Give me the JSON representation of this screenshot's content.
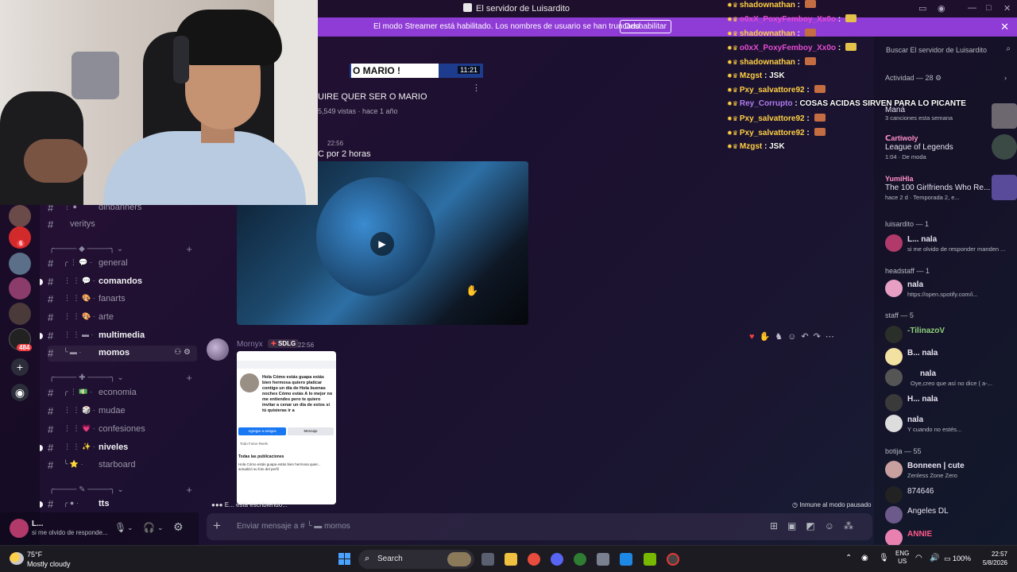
{
  "window": {
    "title": "El servidor de Luisardito"
  },
  "banner": {
    "text": "El modo Streamer está habilitado. Los nombres de usuario se han truncado.",
    "button": "Deshabilitar"
  },
  "server_rail": {
    "badges": [
      "6",
      "484"
    ]
  },
  "channels": {
    "items": [
      {
        "label": "dinbanners"
      },
      {
        "label": "veritys"
      },
      {
        "label": "general"
      },
      {
        "label": "comandos"
      },
      {
        "label": "fanarts"
      },
      {
        "label": "arte"
      },
      {
        "label": "multimedia"
      },
      {
        "label": "momos"
      },
      {
        "label": "economia"
      },
      {
        "label": "mudae"
      },
      {
        "label": "confesiones"
      },
      {
        "label": "niveles"
      },
      {
        "label": "starboard"
      },
      {
        "label": "tts"
      }
    ]
  },
  "user_panel": {
    "name": "L...",
    "status": "si me olvido de responde..."
  },
  "chat": {
    "yt_thumb_text": "O MARIO !",
    "yt_duration": "11:21",
    "yt_title": "UIRE QUER SER O MARIO",
    "yt_meta": "5,549 vistas · hace 1 año",
    "video_time": "22:56",
    "video_caption": "C por 2 horas",
    "message": {
      "author": "Mornyx",
      "tag": "SDLG",
      "time": "22:56"
    },
    "embed": {
      "post_text": "Hola Cómo estás guapa estás bien hermosa quiero platicar contigo un día de Hola buenas noches Cómo estás A lo mejor no me entiendes pero te quiero invitar a cenar un día de estos si tú quisieras ir a",
      "btn_add": "Agregar a amigos",
      "btn_msg": "Mensaje",
      "tabs": "Todo     Fotos     Reels",
      "section": "Todas las publicaciones",
      "preview": "Hola Cómo estás guapa estás bien hermosa quier... actualizó su foto del perfil"
    },
    "typing": "E... está escribiendo...",
    "slowmode": "Inmune al modo pausado",
    "composer_placeholder": "Enviar mensaje a #",
    "composer_channel": "momos"
  },
  "overlay_chat": [
    {
      "user": "shadownathan",
      "msg": "",
      "color": "#ffd045",
      "emote": "orange"
    },
    {
      "user": "o0xX_PoxyFemboy_Xx0o",
      "msg": "",
      "color": "#e34bd0",
      "emote": "yellow"
    },
    {
      "user": "shadownathan",
      "msg": "",
      "color": "#ffd045",
      "emote": "orange"
    },
    {
      "user": "o0xX_PoxyFemboy_Xx0o",
      "msg": "",
      "color": "#e34bd0",
      "emote": "yellow"
    },
    {
      "user": "shadownathan",
      "msg": "",
      "color": "#ffd045",
      "emote": "orange"
    },
    {
      "user": "Mzgst",
      "msg": "JSK",
      "color": "#ffd045",
      "emote": ""
    },
    {
      "user": "Pxy_salvattore92",
      "msg": "",
      "color": "#ffd045",
      "emote": "orange"
    },
    {
      "user": "Rey_Corrupto",
      "msg": "COSAS ACIDAS SIRVEN PARA LO PICANTE",
      "color": "#b07cf0",
      "emote": ""
    },
    {
      "user": "Pxy_salvattore92",
      "msg": "",
      "color": "#ffd045",
      "emote": "orange"
    },
    {
      "user": "Pxy_salvattore92",
      "msg": "",
      "color": "#ffd045",
      "emote": "orange"
    },
    {
      "user": "Mzgst",
      "msg": "JSK",
      "color": "#ffd045",
      "emote": ""
    }
  ],
  "members": {
    "search_placeholder": "Buscar El servidor de Luisardito",
    "activity_title": "Actividad — 28",
    "activity": [
      {
        "name": "Maná",
        "sub": "3 canciones esta semana"
      },
      {
        "name": "League of Legends",
        "sub": "1:04 · De moda"
      },
      {
        "name": "The 100 Girlfriends Who Re...",
        "sub": "hace 2 d · Temporada 2, e..."
      }
    ],
    "groups": [
      {
        "title": "luisardito — 1",
        "rows": [
          {
            "name": "L... nala",
            "sub": "si me olvido de responder manden ..."
          }
        ]
      },
      {
        "title": "headstaff — 1",
        "rows": [
          {
            "name": "nala",
            "sub": "https://open.spotify.com/i..."
          }
        ]
      },
      {
        "title": "staff — 5",
        "rows": [
          {
            "name": "-TilinazoV",
            "sub": ""
          },
          {
            "name": "B... nala",
            "sub": ""
          },
          {
            "name": "nala",
            "sub": "Oye,creo que así no dice ( a-..."
          },
          {
            "name": "H... nala",
            "sub": ""
          },
          {
            "name": "nala",
            "sub": "Y cuando no estés..."
          }
        ]
      },
      {
        "title": "botija — 55",
        "rows": [
          {
            "name": "Bonneen | cute",
            "sub": "Zenless Zone Zero"
          },
          {
            "name": "874646",
            "sub": ""
          },
          {
            "name": "Angeles DL",
            "sub": ""
          },
          {
            "name": "ANNIE",
            "sub": ""
          }
        ]
      }
    ]
  },
  "taskbar": {
    "temp": "75°F",
    "condition": "Mostly cloudy",
    "search": "Search",
    "lang1": "ENG",
    "lang2": "US",
    "battery": "100%",
    "time": "22:57",
    "date": "5/8/2026"
  }
}
